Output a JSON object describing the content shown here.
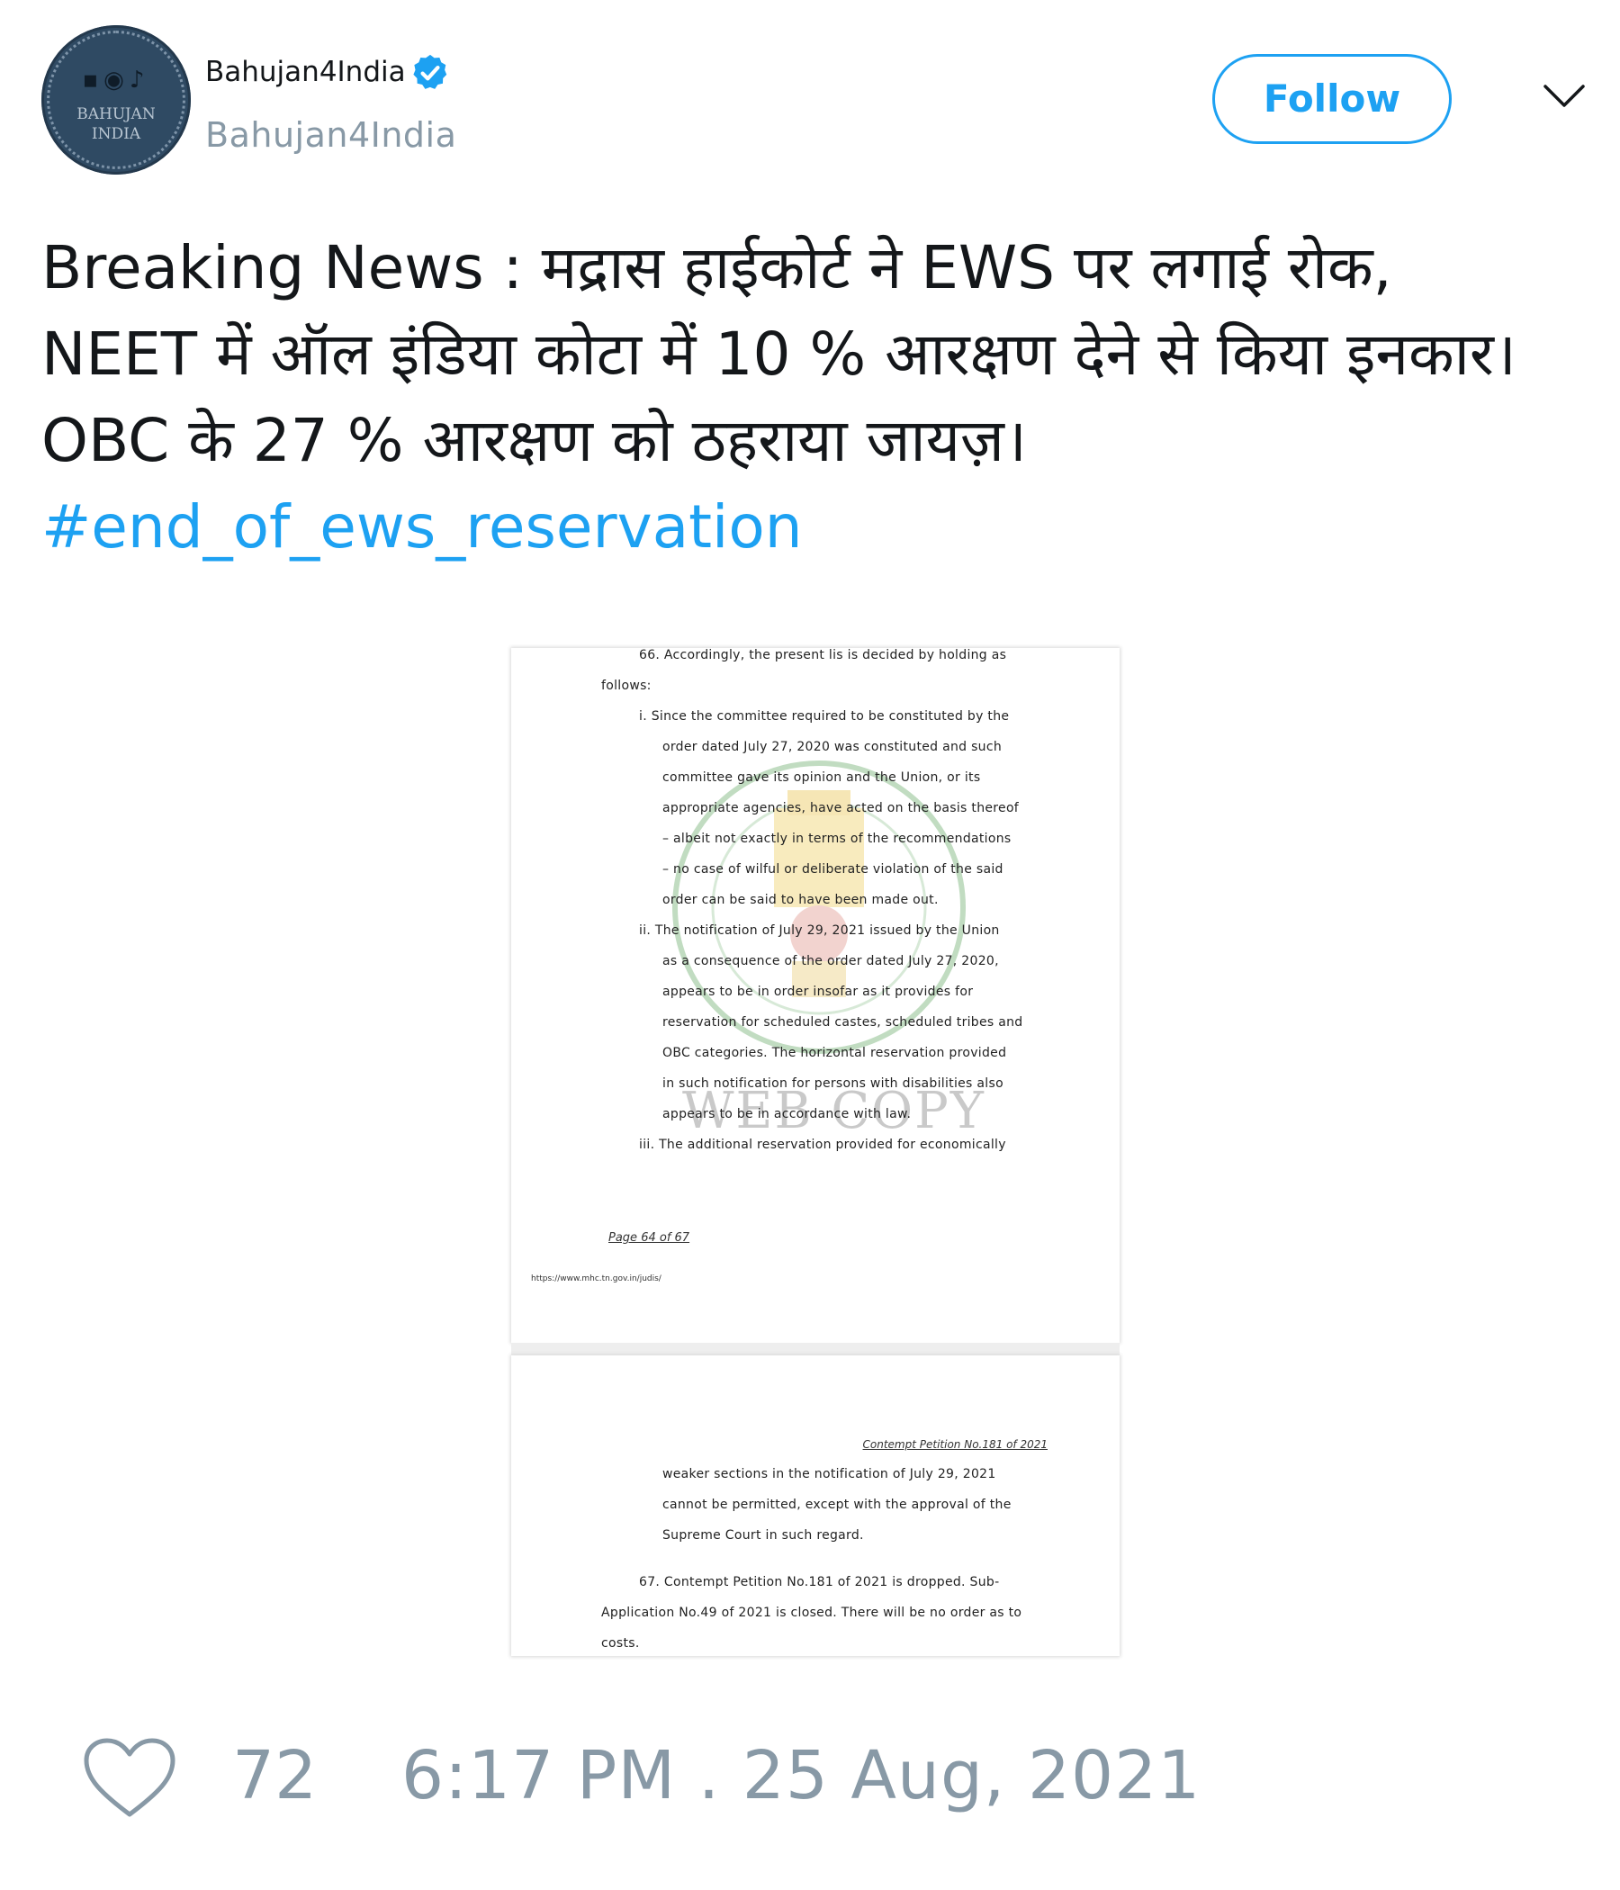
{
  "user": {
    "display_name": "Bahujan4India",
    "handle": "Bahujan4India",
    "avatar_text": [
      "BAHUJAN",
      "INDIA"
    ]
  },
  "actions": {
    "follow_label": "Follow"
  },
  "tweet": {
    "lines": [
      "Breaking News : मद्रास हाईकोर्ट ने EWS पर लगाई रोक,",
      "NEET में ऑल इंडिया कोटा में 10 % आरक्षण देने से किया इनकार।",
      "OBC के 27 % आरक्षण को ठहराया जायज़।"
    ],
    "hashtag": "#end_of_ews_reservation"
  },
  "document": {
    "page1_lines": [
      "66.  Accordingly,  the  present  lis  is  decided  by  holding  as",
      "follows:",
      "i.   Since the committee required to be constituted by the",
      "order dated July 27, 2020 was constituted and such",
      "committee  gave  its  opinion  and  the  Union,  or  its",
      "appropriate agencies, have acted on the basis thereof",
      "– albeit not exactly in terms of the recommendations",
      "– no case of wilful or deliberate violation of the said",
      "order can be said to have been made out.",
      "ii.  The notification of July 29, 2021 issued by the Union",
      "as a consequence of the order dated July 27, 2020,",
      "appears  to  be  in  order  insofar  as  it  provides  for",
      "reservation for scheduled castes, scheduled tribes and",
      "OBC categories.   The horizontal reservation provided",
      "in such notification for persons with disabilities also",
      "appears to be in accordance with law.",
      "iii. The additional reservation provided for economically"
    ],
    "watermark": "WEB COPY",
    "page_number": "Page 64 of 67",
    "url": "https://www.mhc.tn.gov.in/judis/",
    "page2_header": "Contempt Petition No.181 of 2021",
    "page2_lines": [
      "weaker sections in the notification of July 29, 2021",
      "cannot be permitted, except with the approval of the",
      "Supreme Court in such regard.",
      "67.  Contempt  Petition  No.181  of  2021  is  dropped.    Sub-",
      "Application No.49 of 2021 is closed.  There will be no order as to",
      "costs."
    ]
  },
  "footer": {
    "likes": "72",
    "timestamp": "6:17 PM . 25 Aug, 2021"
  },
  "colors": {
    "accent": "#1da1f2",
    "muted": "#8899a6",
    "text": "#14171a"
  },
  "icons": [
    "verified-badge-icon",
    "chevron-down-icon",
    "heart-icon"
  ]
}
